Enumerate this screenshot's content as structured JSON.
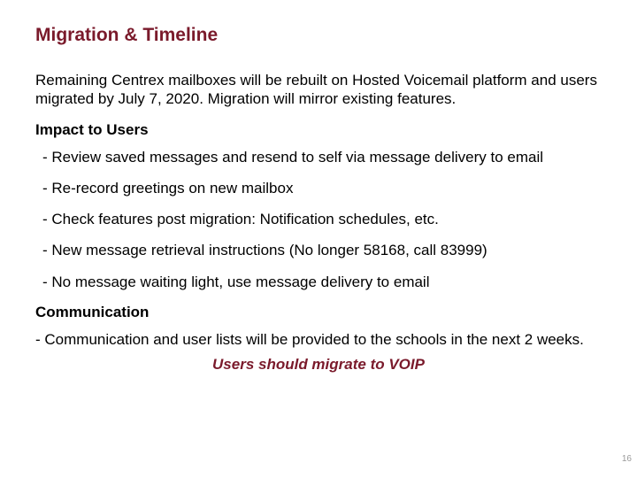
{
  "title": "Migration & Timeline",
  "intro": "Remaining Centrex mailboxes will be rebuilt on Hosted Voicemail platform and users migrated by July 7, 2020.  Migration will mirror existing features.",
  "impact_heading": "Impact to Users",
  "impact_items": [
    "Review saved messages and resend to self via message delivery to email",
    "Re-record greetings on new mailbox",
    "Check features post migration: Notification schedules, etc.",
    "New message retrieval instructions (No longer 58168, call 83999)",
    "No message waiting light, use message delivery to email"
  ],
  "communication_heading": "Communication",
  "communication_text": "- Communication and user lists will be provided to the schools in the next 2 weeks.",
  "callout": "Users should migrate to VOIP",
  "page_number": "16"
}
